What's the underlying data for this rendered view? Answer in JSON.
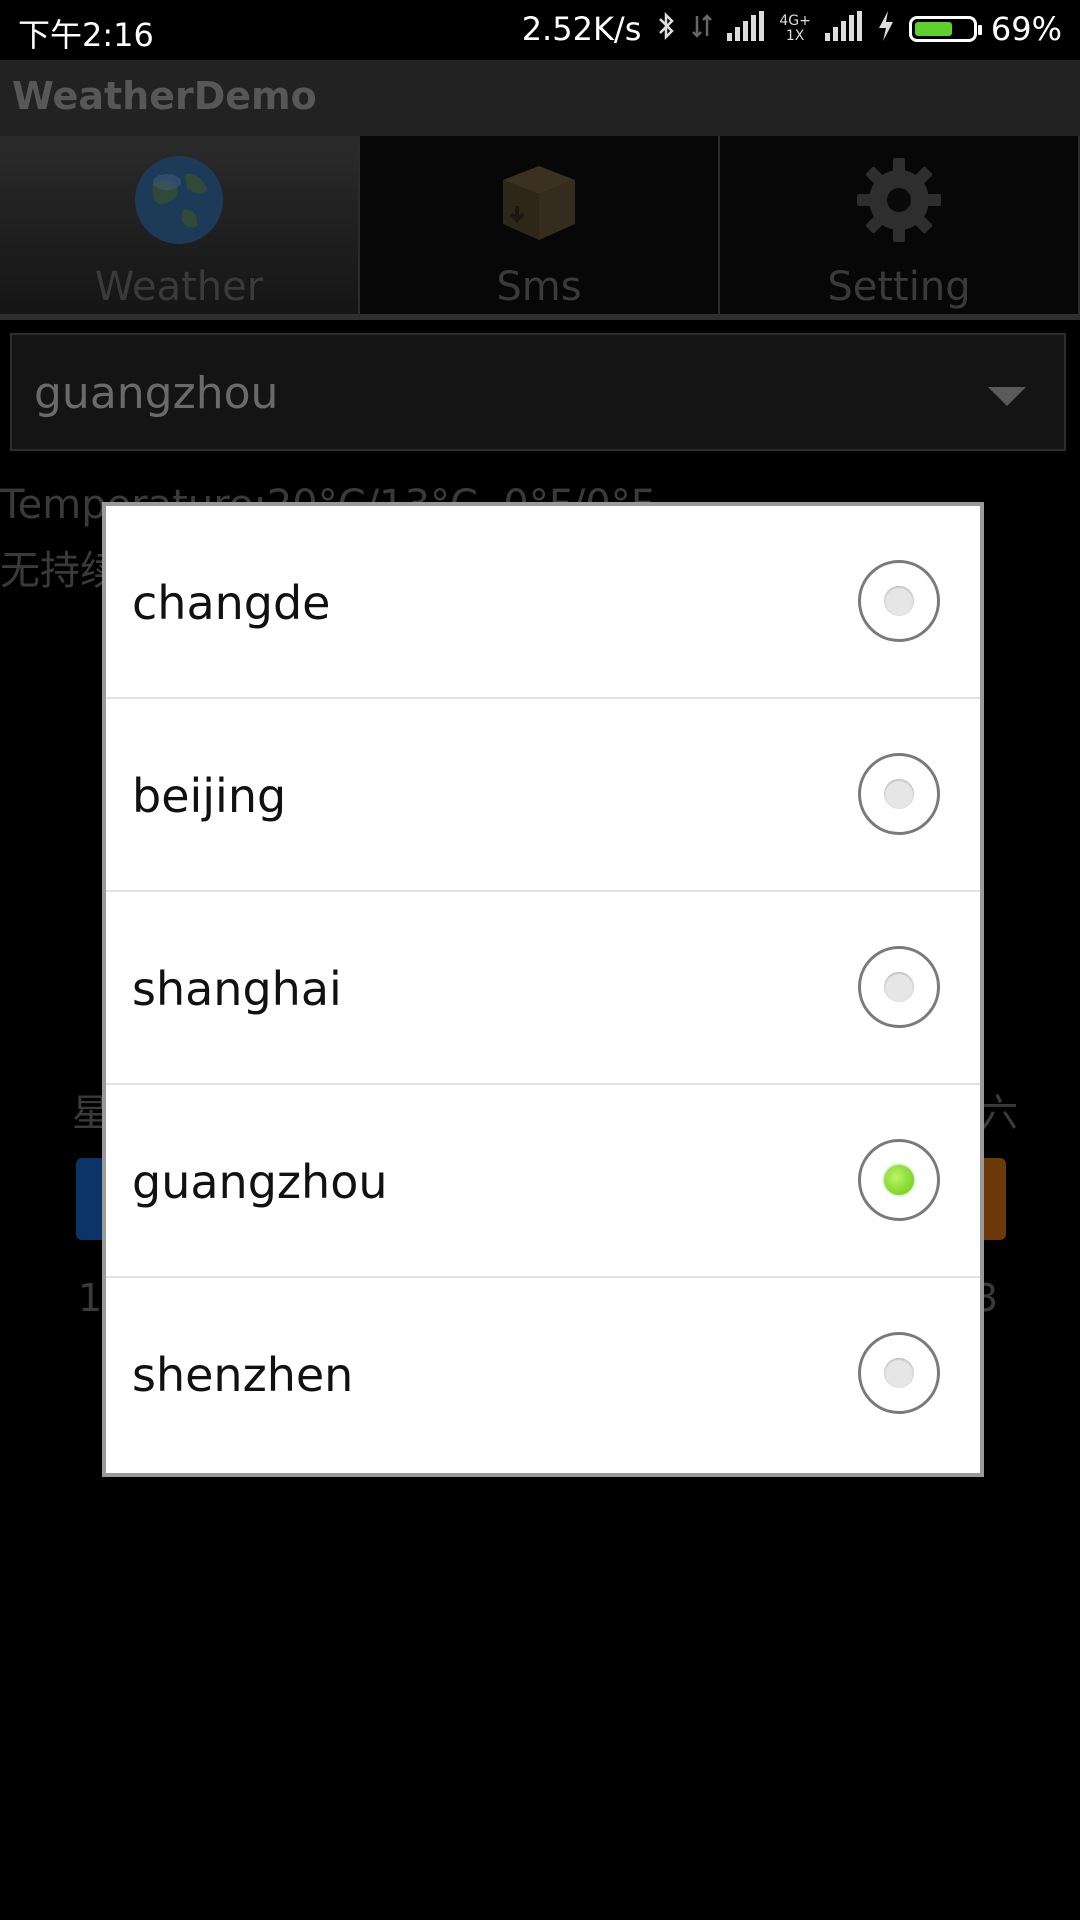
{
  "status_bar": {
    "time": "下午2:16",
    "net_speed": "2.52K/s",
    "net_tag_top": "4G+",
    "net_tag_bottom": "1X",
    "battery_percent": "69%",
    "battery_level": 0.69
  },
  "app": {
    "title": "WeatherDemo"
  },
  "tabs": [
    {
      "label": "Weather",
      "icon": "globe-icon",
      "active": true
    },
    {
      "label": "Sms",
      "icon": "box-icon",
      "active": false
    },
    {
      "label": "Setting",
      "icon": "gear-icon",
      "active": false
    }
  ],
  "spinner": {
    "value": "guangzhou"
  },
  "background": {
    "temperature": "Temperature:20°C/13°C, 0°F/0°F",
    "description": "无持续",
    "week_left": "星",
    "week_right": "六",
    "num_left": "1",
    "num_right": "3"
  },
  "dialog": {
    "options": [
      {
        "label": "changde",
        "checked": false
      },
      {
        "label": "beijing",
        "checked": false
      },
      {
        "label": "shanghai",
        "checked": false
      },
      {
        "label": "guangzhou",
        "checked": true
      },
      {
        "label": "shenzhen",
        "checked": false
      }
    ]
  },
  "colors": {
    "radio_checked": "#67c60e",
    "battery_fill": "#5fd02c"
  }
}
